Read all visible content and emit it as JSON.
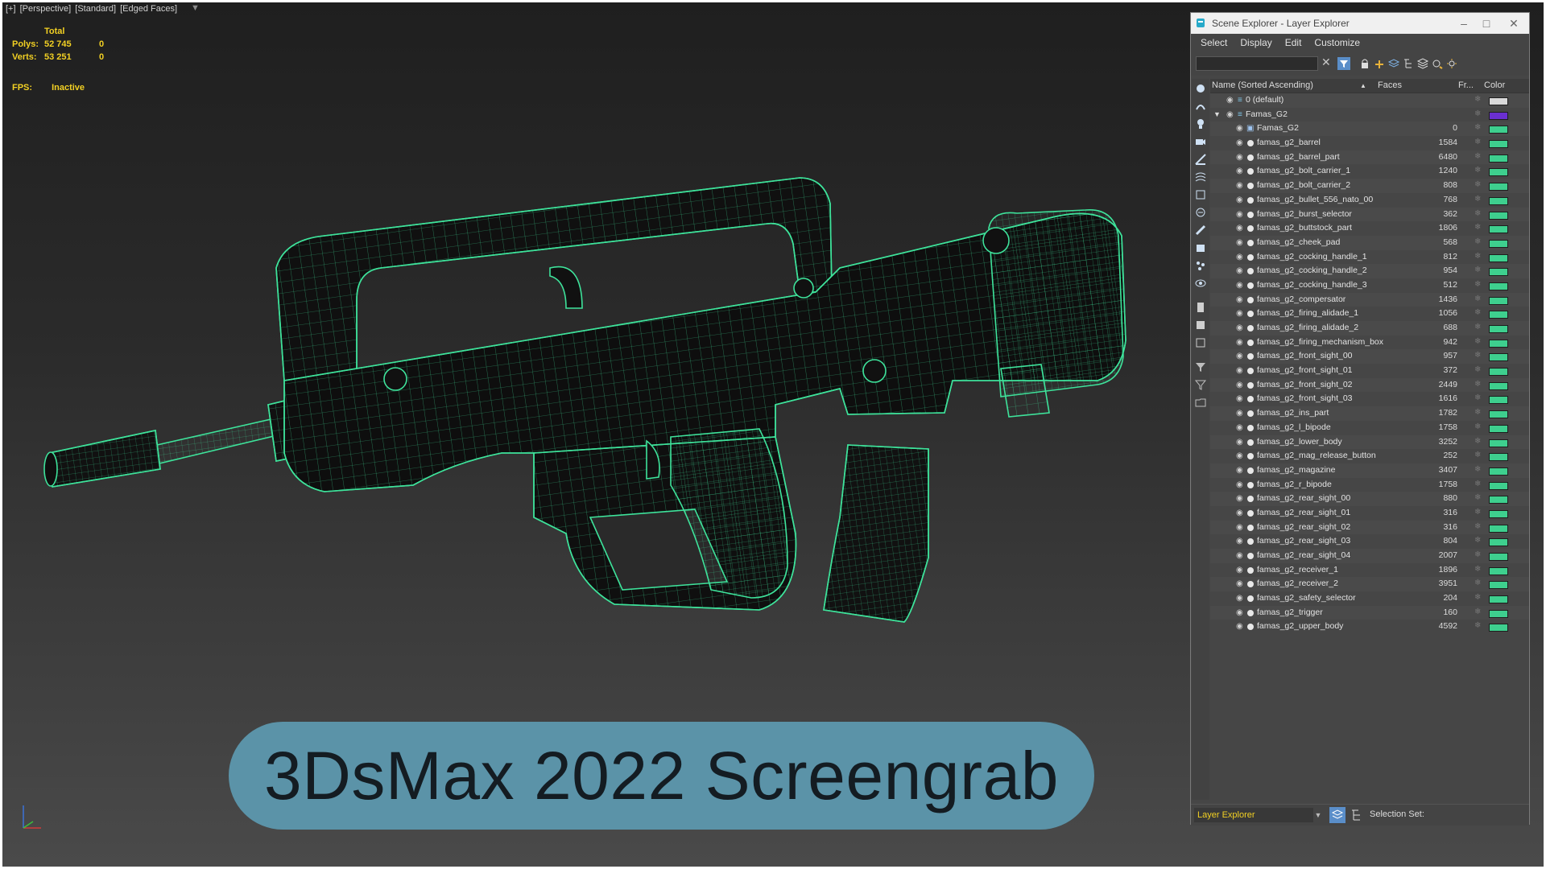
{
  "viewport": {
    "labels": [
      "[+]",
      "[Perspective]",
      "[Standard]",
      "[Edged Faces]"
    ],
    "stats": {
      "total_label": "Total",
      "polys_label": "Polys:",
      "polys_total": "52 745",
      "polys_sel": "0",
      "verts_label": "Verts:",
      "verts_total": "53 251",
      "verts_sel": "0"
    },
    "fps_label": "FPS:",
    "fps_value": "Inactive",
    "wire_color": "#3ee39b"
  },
  "banner": {
    "text": "3DsMax 2022 Screengrab"
  },
  "explorer": {
    "title": "Scene Explorer - Layer Explorer",
    "menu": [
      "Select",
      "Display",
      "Edit",
      "Customize"
    ],
    "columns": {
      "name": "Name (Sorted Ascending)",
      "faces": "Faces",
      "frozen": "Fr...",
      "color": "Color"
    },
    "rows": [
      {
        "name": "0 (default)",
        "faces": "",
        "level": 0,
        "kind": "layer",
        "color": "#d9d9d9"
      },
      {
        "name": "Famas_G2",
        "faces": "",
        "level": 0,
        "kind": "layer-open",
        "color": "#6a2fd0"
      },
      {
        "name": "Famas_G2",
        "faces": "0",
        "level": 1,
        "kind": "group",
        "color": "#3ecf8e"
      },
      {
        "name": "famas_g2_barrel",
        "faces": "1584",
        "level": 1,
        "kind": "mesh",
        "color": "#3ecf8e"
      },
      {
        "name": "famas_g2_barrel_part",
        "faces": "6480",
        "level": 1,
        "kind": "mesh",
        "color": "#3ecf8e"
      },
      {
        "name": "famas_g2_bolt_carrier_1",
        "faces": "1240",
        "level": 1,
        "kind": "mesh",
        "color": "#3ecf8e"
      },
      {
        "name": "famas_g2_bolt_carrier_2",
        "faces": "808",
        "level": 1,
        "kind": "mesh",
        "color": "#3ecf8e"
      },
      {
        "name": "famas_g2_bullet_556_nato_00",
        "faces": "768",
        "level": 1,
        "kind": "mesh",
        "color": "#3ecf8e"
      },
      {
        "name": "famas_g2_burst_selector",
        "faces": "362",
        "level": 1,
        "kind": "mesh",
        "color": "#3ecf8e"
      },
      {
        "name": "famas_g2_buttstock_part",
        "faces": "1806",
        "level": 1,
        "kind": "mesh",
        "color": "#3ecf8e"
      },
      {
        "name": "famas_g2_cheek_pad",
        "faces": "568",
        "level": 1,
        "kind": "mesh",
        "color": "#3ecf8e"
      },
      {
        "name": "famas_g2_cocking_handle_1",
        "faces": "812",
        "level": 1,
        "kind": "mesh",
        "color": "#3ecf8e"
      },
      {
        "name": "famas_g2_cocking_handle_2",
        "faces": "954",
        "level": 1,
        "kind": "mesh",
        "color": "#3ecf8e"
      },
      {
        "name": "famas_g2_cocking_handle_3",
        "faces": "512",
        "level": 1,
        "kind": "mesh",
        "color": "#3ecf8e"
      },
      {
        "name": "famas_g2_compersator",
        "faces": "1436",
        "level": 1,
        "kind": "mesh",
        "color": "#3ecf8e"
      },
      {
        "name": "famas_g2_firing_alidade_1",
        "faces": "1056",
        "level": 1,
        "kind": "mesh",
        "color": "#3ecf8e"
      },
      {
        "name": "famas_g2_firing_alidade_2",
        "faces": "688",
        "level": 1,
        "kind": "mesh",
        "color": "#3ecf8e"
      },
      {
        "name": "famas_g2_firing_mechanism_box",
        "faces": "942",
        "level": 1,
        "kind": "mesh",
        "color": "#3ecf8e"
      },
      {
        "name": "famas_g2_front_sight_00",
        "faces": "957",
        "level": 1,
        "kind": "mesh",
        "color": "#3ecf8e"
      },
      {
        "name": "famas_g2_front_sight_01",
        "faces": "372",
        "level": 1,
        "kind": "mesh",
        "color": "#3ecf8e"
      },
      {
        "name": "famas_g2_front_sight_02",
        "faces": "2449",
        "level": 1,
        "kind": "mesh",
        "color": "#3ecf8e"
      },
      {
        "name": "famas_g2_front_sight_03",
        "faces": "1616",
        "level": 1,
        "kind": "mesh",
        "color": "#3ecf8e"
      },
      {
        "name": "famas_g2_ins_part",
        "faces": "1782",
        "level": 1,
        "kind": "mesh",
        "color": "#3ecf8e"
      },
      {
        "name": "famas_g2_l_bipode",
        "faces": "1758",
        "level": 1,
        "kind": "mesh",
        "color": "#3ecf8e"
      },
      {
        "name": "famas_g2_lower_body",
        "faces": "3252",
        "level": 1,
        "kind": "mesh",
        "color": "#3ecf8e"
      },
      {
        "name": "famas_g2_mag_release_button",
        "faces": "252",
        "level": 1,
        "kind": "mesh",
        "color": "#3ecf8e"
      },
      {
        "name": "famas_g2_magazine",
        "faces": "3407",
        "level": 1,
        "kind": "mesh",
        "color": "#3ecf8e"
      },
      {
        "name": "famas_g2_r_bipode",
        "faces": "1758",
        "level": 1,
        "kind": "mesh",
        "color": "#3ecf8e"
      },
      {
        "name": "famas_g2_rear_sight_00",
        "faces": "880",
        "level": 1,
        "kind": "mesh",
        "color": "#3ecf8e"
      },
      {
        "name": "famas_g2_rear_sight_01",
        "faces": "316",
        "level": 1,
        "kind": "mesh",
        "color": "#3ecf8e"
      },
      {
        "name": "famas_g2_rear_sight_02",
        "faces": "316",
        "level": 1,
        "kind": "mesh",
        "color": "#3ecf8e"
      },
      {
        "name": "famas_g2_rear_sight_03",
        "faces": "804",
        "level": 1,
        "kind": "mesh",
        "color": "#3ecf8e"
      },
      {
        "name": "famas_g2_rear_sight_04",
        "faces": "2007",
        "level": 1,
        "kind": "mesh",
        "color": "#3ecf8e"
      },
      {
        "name": "famas_g2_receiver_1",
        "faces": "1896",
        "level": 1,
        "kind": "mesh",
        "color": "#3ecf8e"
      },
      {
        "name": "famas_g2_receiver_2",
        "faces": "3951",
        "level": 1,
        "kind": "mesh",
        "color": "#3ecf8e"
      },
      {
        "name": "famas_g2_safety_selector",
        "faces": "204",
        "level": 1,
        "kind": "mesh",
        "color": "#3ecf8e"
      },
      {
        "name": "famas_g2_trigger",
        "faces": "160",
        "level": 1,
        "kind": "mesh",
        "color": "#3ecf8e"
      },
      {
        "name": "famas_g2_upper_body",
        "faces": "4592",
        "level": 1,
        "kind": "mesh",
        "color": "#3ecf8e"
      }
    ],
    "bottom": {
      "layer_dropdown": "Layer Explorer",
      "selection_set_label": "Selection Set:"
    }
  }
}
